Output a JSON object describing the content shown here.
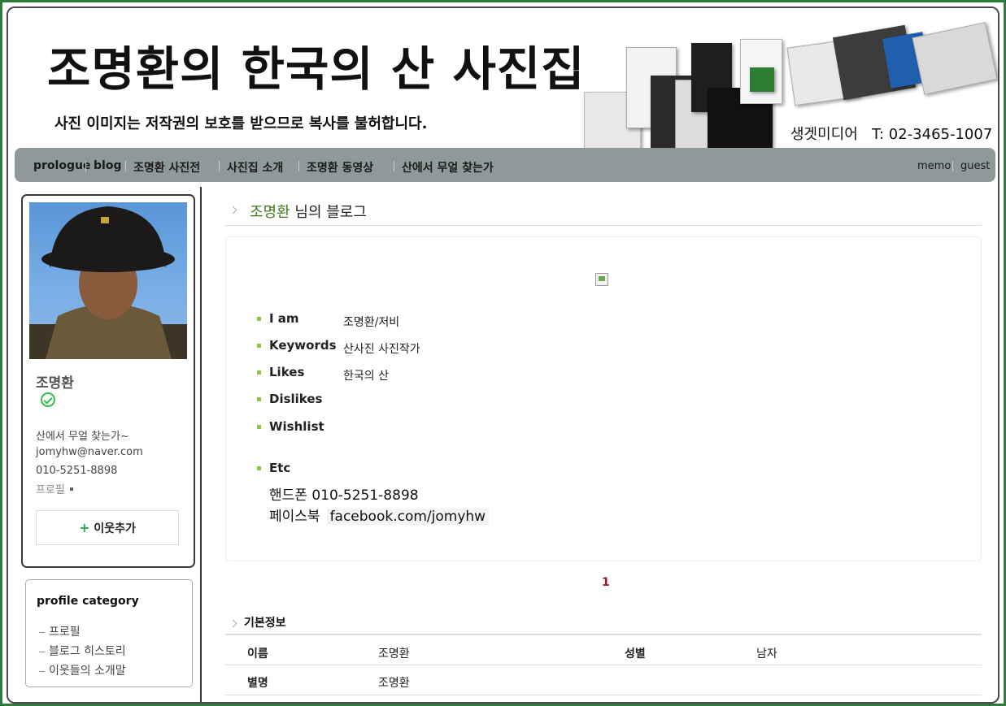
{
  "header": {
    "title": "조명환의 한국의 산 사진집",
    "subtitle": "사진 이미지는 저작권의 보호를 받으므로 복사를 불허합니다.",
    "contact": "생겟미디어   T: 02-3465-1007"
  },
  "nav": {
    "items": [
      "prologue",
      "blog",
      "조명환 사진전",
      "사진집 소개",
      "조명환 동영상",
      "산에서 무얼 찾는가"
    ],
    "right": [
      "memo",
      "guest"
    ]
  },
  "profile": {
    "name": "조명환",
    "tagline": "산에서 무얼 찾는가~",
    "email": "jomyhw@naver.com",
    "phone": "010-5251-8898",
    "profile_link": "프로필",
    "add_neighbor_plus": "+",
    "add_neighbor": "이웃추가"
  },
  "category": {
    "title": "profile category",
    "items": [
      "프로필",
      "블로그 히스토리",
      "이웃들의 소개말"
    ]
  },
  "main": {
    "blog_owner": "조명환",
    "blog_suffix": " 님의 블로그",
    "info": [
      {
        "label": "I am",
        "value": "조명환/저비"
      },
      {
        "label": "Keywords",
        "value": "산사진 사진작가"
      },
      {
        "label": "Likes",
        "value": "한국의 산"
      },
      {
        "label": "Dislikes",
        "value": ""
      },
      {
        "label": "Wishlist",
        "value": ""
      }
    ],
    "etc_label": "Etc",
    "etc_phone_label": "핸드폰",
    "etc_phone": "010-5251-8898",
    "etc_fb_label": "페이스북",
    "etc_fb": "facebook.com/jomyhw",
    "page": "1"
  },
  "basic": {
    "title": "기본정보",
    "row1": {
      "k1": "이름",
      "v1": "조명환",
      "k2": "성별",
      "v2": "남자"
    },
    "row2": {
      "k1": "별명",
      "v1": "조명환"
    }
  },
  "colors": {
    "frame": "#2f7a3a",
    "nav": "#8f999a",
    "accent_green": "#3d7b1c",
    "page_num": "#9b1b30"
  }
}
